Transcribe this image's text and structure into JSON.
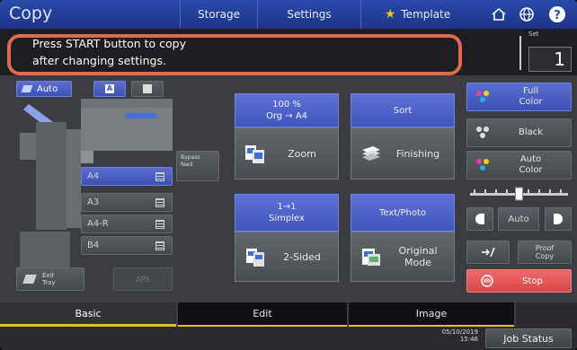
{
  "header": {
    "app_title": "Copy",
    "tabs": [
      "Storage",
      "Settings",
      "Template"
    ],
    "icons": [
      "home-icon",
      "globe-icon",
      "help-icon"
    ]
  },
  "message": {
    "line1": "Press START button to copy",
    "line2": "after changing settings."
  },
  "set": {
    "label": "Set",
    "value": "1"
  },
  "left": {
    "auto_label": "Auto",
    "paper_a": "A",
    "bypass_label_1": "Bypass",
    "bypass_label_2": "feed",
    "trays": [
      "A4",
      "A3",
      "A4-R",
      "B4"
    ],
    "exit_tray_1": "Exit",
    "exit_tray_2": "Tray",
    "aps_label": "APS"
  },
  "functions": {
    "zoom_head_1": "100 %",
    "zoom_head_2": "Org  →  A4",
    "zoom_label": "Zoom",
    "finishing_head": "Sort",
    "finishing_label": "Finishing",
    "sided_head_1": "1→1",
    "sided_head_2": "Simplex",
    "sided_label": "2-Sided",
    "mode_head": "Text/Photo",
    "mode_label_1": "Original",
    "mode_label_2": "Mode"
  },
  "color": {
    "full_1": "Full",
    "full_2": "Color",
    "black": "Black",
    "auto_1": "Auto",
    "auto_2": "Color"
  },
  "density": {
    "label": "Auto",
    "level": 0.5
  },
  "actions": {
    "proof_1": "Proof",
    "proof_2": "Copy",
    "stop": "Stop"
  },
  "bottom_tabs": [
    "Basic",
    "Edit",
    "Image"
  ],
  "status": {
    "date": "05/10/2019",
    "time": "15:46",
    "job_status": "Job Status"
  },
  "colors": {
    "header_blue": "#2a4aa8",
    "accent_blue": "#4f63c8",
    "highlight_orange": "#e06a50",
    "stop_red": "#e05050",
    "tab_yellow": "#e8c020"
  }
}
